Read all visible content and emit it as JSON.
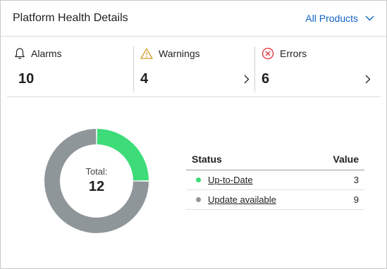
{
  "header": {
    "title": "Platform Health Details",
    "filter_label": "All Products"
  },
  "metrics": [
    {
      "label": "Alarms",
      "value": "10",
      "icon": "bell-icon"
    },
    {
      "label": "Warnings",
      "value": "4",
      "icon": "warning-triangle-icon"
    },
    {
      "label": "Errors",
      "value": "6",
      "icon": "error-circle-icon"
    }
  ],
  "donut": {
    "center_label": "Total:",
    "center_value": "12"
  },
  "table": {
    "status_header": "Status",
    "value_header": "Value",
    "rows": [
      {
        "status": "Up-to-Date",
        "value": "3",
        "color": "#3ddc78"
      },
      {
        "status": "Update available",
        "value": "9",
        "color": "#8f969a"
      }
    ]
  },
  "chart_data": {
    "type": "pie",
    "categories": [
      "Up-to-Date",
      "Update available"
    ],
    "values": [
      3,
      9
    ],
    "colors": [
      "#3ddc78",
      "#8f969a"
    ],
    "title": ""
  }
}
